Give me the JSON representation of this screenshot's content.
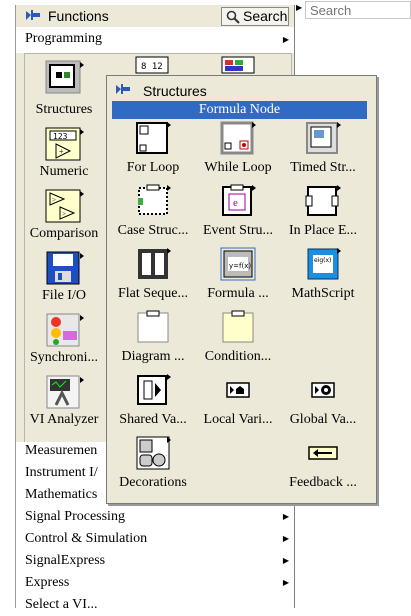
{
  "functions_palette": {
    "title": "Functions",
    "search_label": "Search",
    "programming_label": "Programming",
    "categories": [
      {
        "label": "Structures"
      },
      {
        "label": "Numeric"
      },
      {
        "label": "Comparison"
      },
      {
        "label": "File I/O"
      },
      {
        "label": "Synchroni..."
      },
      {
        "label": "VI Analyzer"
      }
    ],
    "list": [
      {
        "label": "Measuremen"
      },
      {
        "label": "Instrument I/"
      },
      {
        "label": "Mathematics"
      },
      {
        "label": "Signal Processing"
      },
      {
        "label": "Control & Simulation"
      },
      {
        "label": "SignalExpress"
      },
      {
        "label": "Express"
      },
      {
        "label": "Select a VI..."
      }
    ]
  },
  "search_field": {
    "placeholder": "Search"
  },
  "structures_palette": {
    "title": "Structures",
    "highlighted": "Formula Node",
    "items": [
      {
        "label": "For Loop"
      },
      {
        "label": "While Loop"
      },
      {
        "label": "Timed Str..."
      },
      {
        "label": "Case Struc..."
      },
      {
        "label": "Event Stru..."
      },
      {
        "label": "In Place E..."
      },
      {
        "label": "Flat Seque..."
      },
      {
        "label": "Formula ..."
      },
      {
        "label": "MathScript"
      },
      {
        "label": "Diagram ..."
      },
      {
        "label": "Condition..."
      },
      {
        "label": "Shared Va..."
      },
      {
        "label": "Local Vari..."
      },
      {
        "label": "Global Va..."
      },
      {
        "label": "Decorations"
      },
      {
        "label": "Feedback ..."
      }
    ]
  },
  "colors": {
    "selection": "#316ac5",
    "palette_bg": "#ece9d8"
  }
}
